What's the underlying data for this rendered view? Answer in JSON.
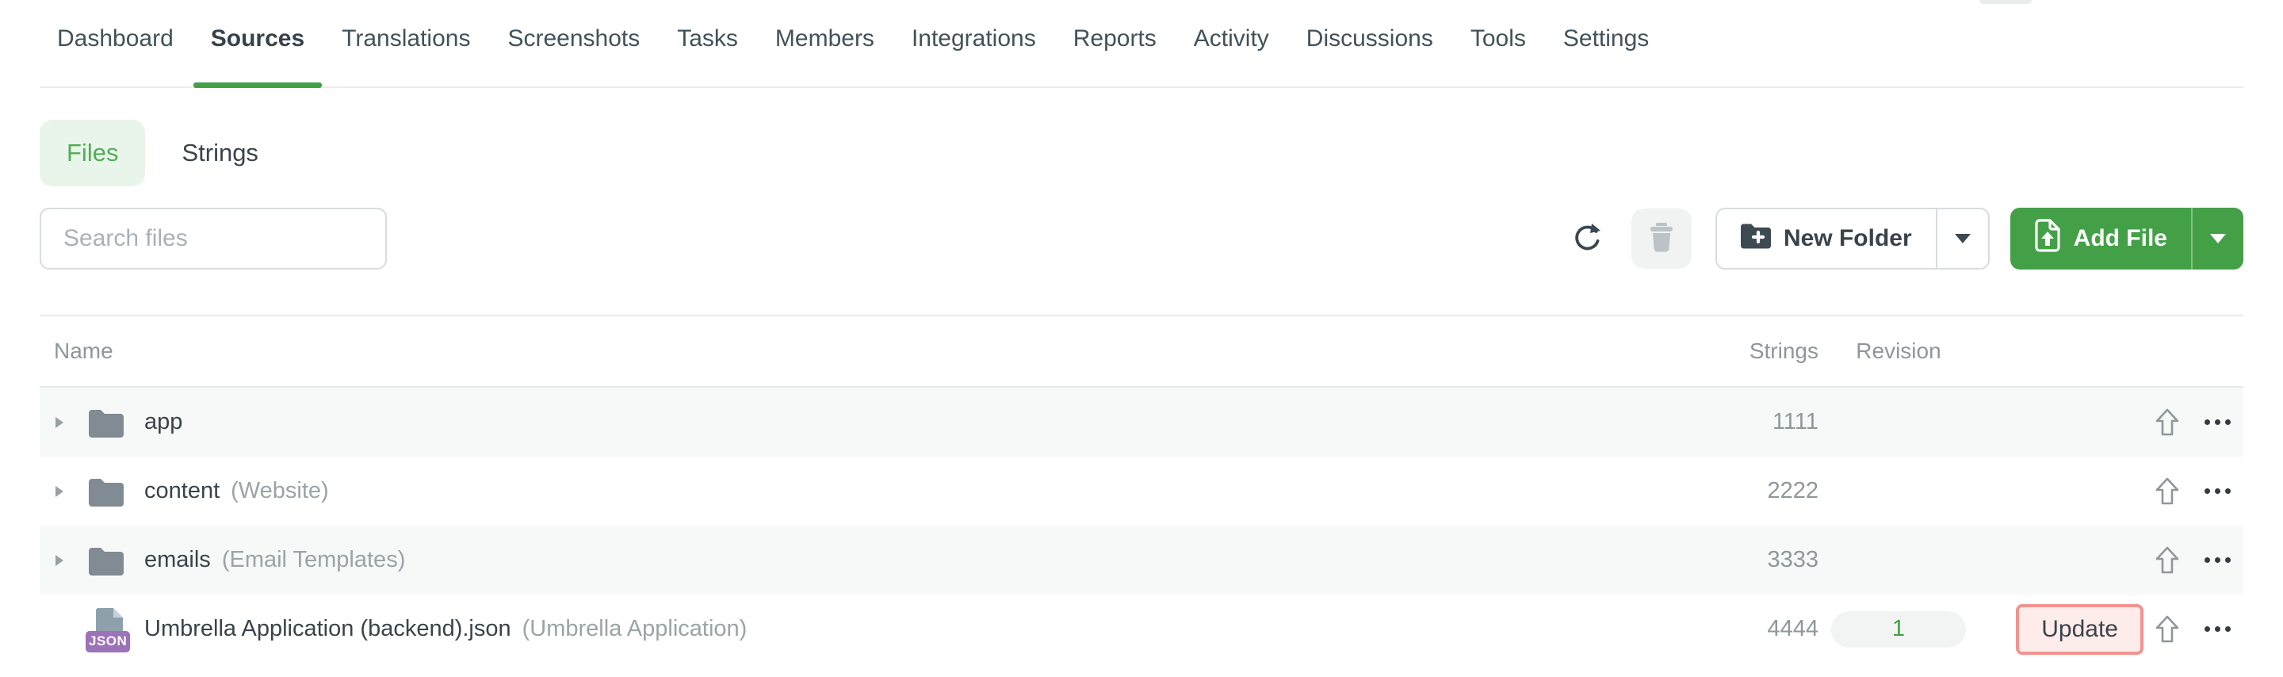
{
  "nav": {
    "items": [
      {
        "label": "Dashboard"
      },
      {
        "label": "Sources",
        "active": true
      },
      {
        "label": "Translations"
      },
      {
        "label": "Screenshots"
      },
      {
        "label": "Tasks"
      },
      {
        "label": "Members"
      },
      {
        "label": "Integrations"
      },
      {
        "label": "Reports"
      },
      {
        "label": "Activity"
      },
      {
        "label": "Discussions"
      },
      {
        "label": "Tools"
      },
      {
        "label": "Settings"
      }
    ]
  },
  "view_toggle": {
    "files_label": "Files",
    "strings_label": "Strings",
    "active": "Files"
  },
  "search": {
    "placeholder": "Search files"
  },
  "toolbar": {
    "new_folder_label": "New Folder",
    "add_file_label": "Add File"
  },
  "table": {
    "columns": [
      {
        "label": "Name"
      },
      {
        "label": "Strings"
      },
      {
        "label": "Revision"
      }
    ],
    "rows": [
      {
        "type": "folder",
        "name": "app",
        "secondary": "",
        "strings": "1111",
        "revision": "",
        "update_label": ""
      },
      {
        "type": "folder",
        "name": "content",
        "secondary": "(Website)",
        "strings": "2222",
        "revision": "",
        "update_label": ""
      },
      {
        "type": "folder",
        "name": "emails",
        "secondary": "(Email Templates)",
        "strings": "3333",
        "revision": "",
        "update_label": ""
      },
      {
        "type": "file",
        "name": "Umbrella Application (backend).json",
        "secondary": "(Umbrella Application)",
        "strings": "4444",
        "revision": "1",
        "update_label": "Update",
        "badge": "JSON",
        "update_highlighted": true
      }
    ]
  },
  "colors": {
    "accent_green": "#43a047",
    "files_pill_bg": "#e9f5ea",
    "files_pill_text": "#53ae57",
    "row_stripe": "#f7f8f8",
    "update_highlight_bg": "#fdecea",
    "update_highlight_border": "#f19490",
    "json_badge_purple": "#9c72b8",
    "revision_text_green": "#43a047"
  }
}
